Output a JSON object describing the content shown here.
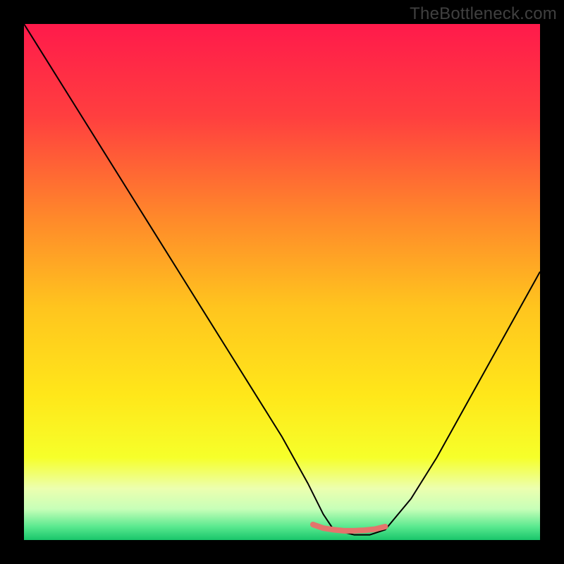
{
  "watermark": "TheBottleneck.com",
  "chart_data": {
    "type": "line",
    "title": "",
    "xlabel": "",
    "ylabel": "",
    "xlim": [
      0,
      100
    ],
    "ylim": [
      0,
      100
    ],
    "grid": false,
    "legend": false,
    "gradient_stops": [
      {
        "pos": 0.0,
        "color": "#ff1a4b"
      },
      {
        "pos": 0.18,
        "color": "#ff3f3f"
      },
      {
        "pos": 0.38,
        "color": "#ff8a2a"
      },
      {
        "pos": 0.55,
        "color": "#ffc51e"
      },
      {
        "pos": 0.72,
        "color": "#ffe71a"
      },
      {
        "pos": 0.84,
        "color": "#f6ff2a"
      },
      {
        "pos": 0.9,
        "color": "#ecffaf"
      },
      {
        "pos": 0.94,
        "color": "#c7ffb8"
      },
      {
        "pos": 0.975,
        "color": "#57e88e"
      },
      {
        "pos": 1.0,
        "color": "#19c56a"
      }
    ],
    "series": [
      {
        "name": "bottleneck-curve",
        "color": "#000000",
        "width": 2,
        "x": [
          0,
          5,
          10,
          15,
          20,
          25,
          30,
          35,
          40,
          45,
          50,
          55,
          58,
          60,
          64,
          67,
          70,
          75,
          80,
          85,
          90,
          95,
          100
        ],
        "y": [
          100,
          92,
          84,
          76,
          68,
          60,
          52,
          44,
          36,
          28,
          20,
          11,
          5,
          2,
          1,
          1,
          2,
          8,
          16,
          25,
          34,
          43,
          52
        ]
      },
      {
        "name": "marker-segment",
        "color": "#e4746c",
        "width": 8,
        "linecap": "round",
        "x": [
          56,
          58,
          60,
          62,
          64,
          66,
          68,
          70
        ],
        "y": [
          3.0,
          2.3,
          2.0,
          1.8,
          1.8,
          1.9,
          2.1,
          2.6
        ]
      }
    ]
  }
}
